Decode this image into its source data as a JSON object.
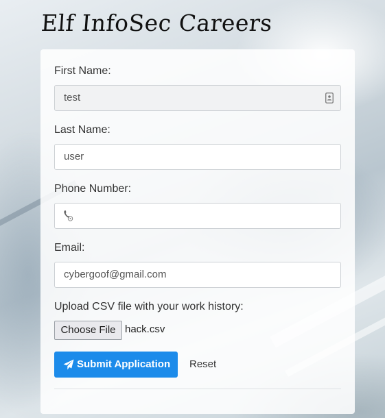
{
  "page": {
    "title": "Elf InfoSec Careers"
  },
  "form": {
    "first_name": {
      "label": "First Name:",
      "value": "test"
    },
    "last_name": {
      "label": "Last Name:",
      "value": "user"
    },
    "phone": {
      "label": "Phone Number:",
      "value": ""
    },
    "email": {
      "label": "Email:",
      "value": "cybergoof@gmail.com"
    },
    "upload": {
      "label": "Upload CSV file with your work history:",
      "button_label": "Choose File",
      "file_name": "hack.csv"
    },
    "submit_label": "Submit Application",
    "reset_label": "Reset"
  },
  "colors": {
    "accent": "#1c8bea"
  },
  "icons": {
    "first_name_field": "contact-card-icon",
    "phone_field": "phone-icon",
    "submit": "paper-plane-icon"
  }
}
